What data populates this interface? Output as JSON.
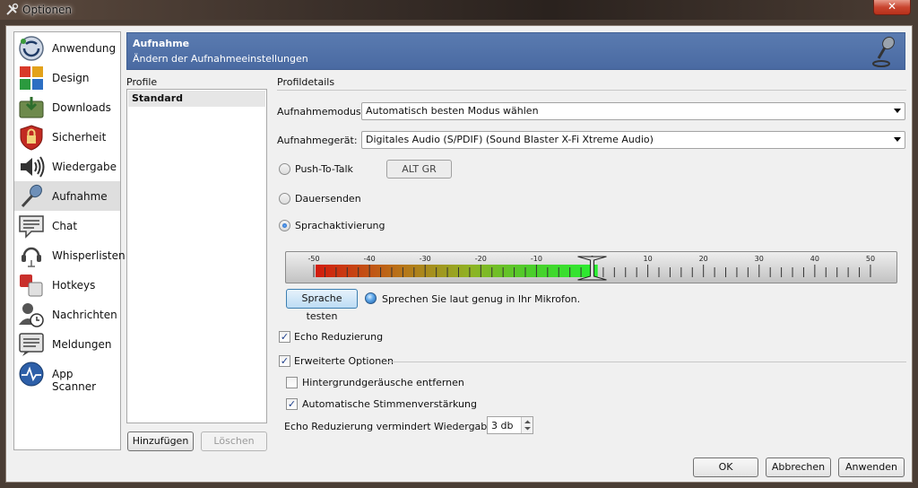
{
  "window": {
    "title": "Optionen",
    "close_glyph": "✕"
  },
  "sidebar": {
    "items": [
      {
        "label": "Anwendung",
        "icon": "teamspeak-logo-icon"
      },
      {
        "label": "Design",
        "icon": "color-palette-icon"
      },
      {
        "label": "Downloads",
        "icon": "download-folder-icon"
      },
      {
        "label": "Sicherheit",
        "icon": "lock-shield-icon"
      },
      {
        "label": "Wiedergabe",
        "icon": "speaker-icon"
      },
      {
        "label": "Aufnahme",
        "icon": "microphone-icon",
        "selected": true
      },
      {
        "label": "Chat",
        "icon": "chat-bubble-icon"
      },
      {
        "label": "Whisperlisten",
        "icon": "headset-icon"
      },
      {
        "label": "Hotkeys",
        "icon": "keys-icon"
      },
      {
        "label": "Nachrichten",
        "icon": "user-clock-icon"
      },
      {
        "label": "Meldungen",
        "icon": "notification-icon"
      },
      {
        "label": "App Scanner",
        "icon": "scanner-icon"
      }
    ]
  },
  "header": {
    "title": "Aufnahme",
    "subtitle": "Ändern der Aufnahmeeinstellungen"
  },
  "profiles": {
    "label": "Profile",
    "items": [
      "Standard"
    ],
    "add_button": "Hinzufügen",
    "delete_button": "Löschen"
  },
  "details": {
    "label": "Profildetails",
    "mode_label": "Aufnahmemodus:",
    "mode_value": "Automatisch besten Modus wählen",
    "device_label": "Aufnahmegerät:",
    "device_value": "Digitales Audio (S/PDIF) (Sound Blaster X-Fi Xtreme Audio)",
    "ptt_label": "Push-To-Talk",
    "ptt_hotkey": "ALT GR",
    "continuous_label": "Dauersenden",
    "voice_activation_label": "Sprachaktivierung",
    "activation_mode": "Sprachaktivierung",
    "meter_ticks": [
      "-50",
      "-40",
      "-30",
      "-20",
      "-10",
      "0",
      "10",
      "20",
      "30",
      "40",
      "50"
    ],
    "meter_level_db": 1,
    "meter_threshold_db": 0,
    "test_button": "Sprache testen",
    "test_hint": "Sprechen Sie laut genug in Ihr Mikrofon.",
    "echo_label": "Echo Reduzierung",
    "echo_checked": true,
    "advanced_label": "Erweiterte Optionen",
    "advanced_checked": true,
    "noise_label": "Hintergrundgeräusche entfernen",
    "noise_checked": false,
    "agc_label": "Automatische Stimmenverstärkung",
    "agc_checked": true,
    "echo_reduce_label": "Echo Reduzierung vermindert Wiedergabe um:",
    "echo_reduce_value": "3 db"
  },
  "footer": {
    "ok": "OK",
    "cancel": "Abbrechen",
    "apply": "Anwenden"
  }
}
